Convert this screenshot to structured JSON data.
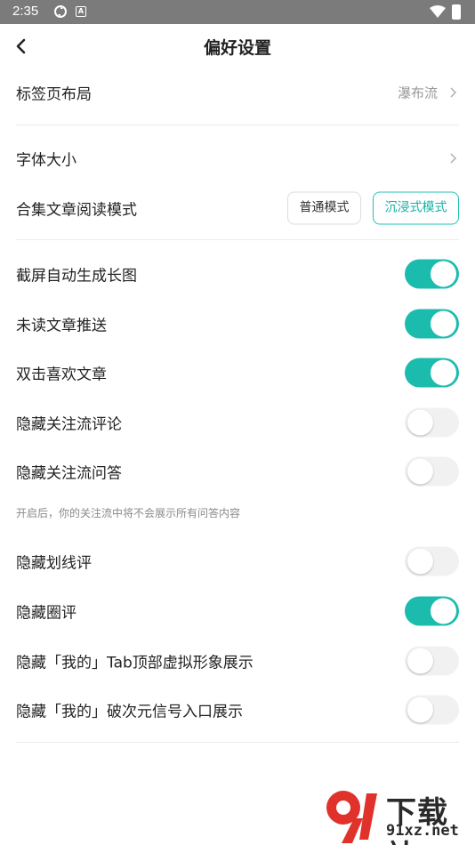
{
  "status_bar": {
    "time": "2:35"
  },
  "header": {
    "title": "偏好设置"
  },
  "items": {
    "tab_layout": {
      "label": "标签页布局",
      "value": "瀑布流"
    },
    "font_size": {
      "label": "字体大小"
    },
    "collection_mode": {
      "label": "合集文章阅读模式",
      "option_normal": "普通模式",
      "option_immersive": "沉浸式模式",
      "selected": "沉浸式模式"
    },
    "screenshot_long": {
      "label": "截屏自动生成长图",
      "on": true
    },
    "unread_push": {
      "label": "未读文章推送",
      "on": true
    },
    "double_tap_like": {
      "label": "双击喜欢文章",
      "on": true
    },
    "hide_follow_comments": {
      "label": "隐藏关注流评论",
      "on": false
    },
    "hide_follow_qa": {
      "label": "隐藏关注流问答",
      "on": false,
      "hint": "开启后，你的关注流中将不会展示所有问答内容"
    },
    "hide_underline_comments": {
      "label": "隐藏划线评",
      "on": false
    },
    "hide_circle_comments": {
      "label": "隐藏圈评",
      "on": true
    },
    "hide_mine_avatar": {
      "label": "隐藏「我的」Tab顶部虚拟形象展示",
      "on": false
    },
    "hide_mine_dimension": {
      "label": "隐藏「我的」破次元信号入口展示",
      "on": false
    }
  },
  "watermark": {
    "title": "下载站",
    "url": "91xz.net"
  },
  "colors": {
    "accent": "#1bbcae",
    "status_bar": "#7b7b7b",
    "watermark_red": "#e0312a"
  }
}
